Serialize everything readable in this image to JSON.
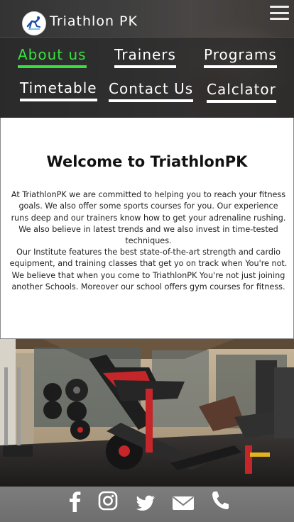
{
  "brand": {
    "name": "Triathlon PK"
  },
  "nav": {
    "items": [
      {
        "label": "About us",
        "active": true
      },
      {
        "label": "Trainers",
        "active": false
      },
      {
        "label": "Programs",
        "active": false
      },
      {
        "label": "Timetable",
        "active": false
      },
      {
        "label": "Contact Us",
        "active": false
      },
      {
        "label": "Calclator",
        "active": false
      }
    ]
  },
  "content": {
    "heading": "Welcome to TriathlonPK",
    "paragraph1": "At TriathlonPK  we are committed to helping you to reach your fitness goals. We also offer some sports courses for you. Our experience runs deep and our trainers know how to get your adrenaline rushing. We also believe in latest trends and we also invest in time-tested techniques.",
    "paragraph2": "Our Institute features the best state-of-the-art strength and cardio equipment, and training classes that get yo on track when You're not. We believe that when you come to TriathlonPK You're not just joining another Schools. Moreover our school offers gym courses for fitness."
  },
  "footer": {
    "icons": [
      "facebook-icon",
      "instagram-icon",
      "twitter-icon",
      "mail-icon",
      "phone-icon"
    ]
  },
  "colors": {
    "active_nav": "#35e23c",
    "footer_bg": "#757575",
    "nav_panel": "#2a2a2a"
  }
}
